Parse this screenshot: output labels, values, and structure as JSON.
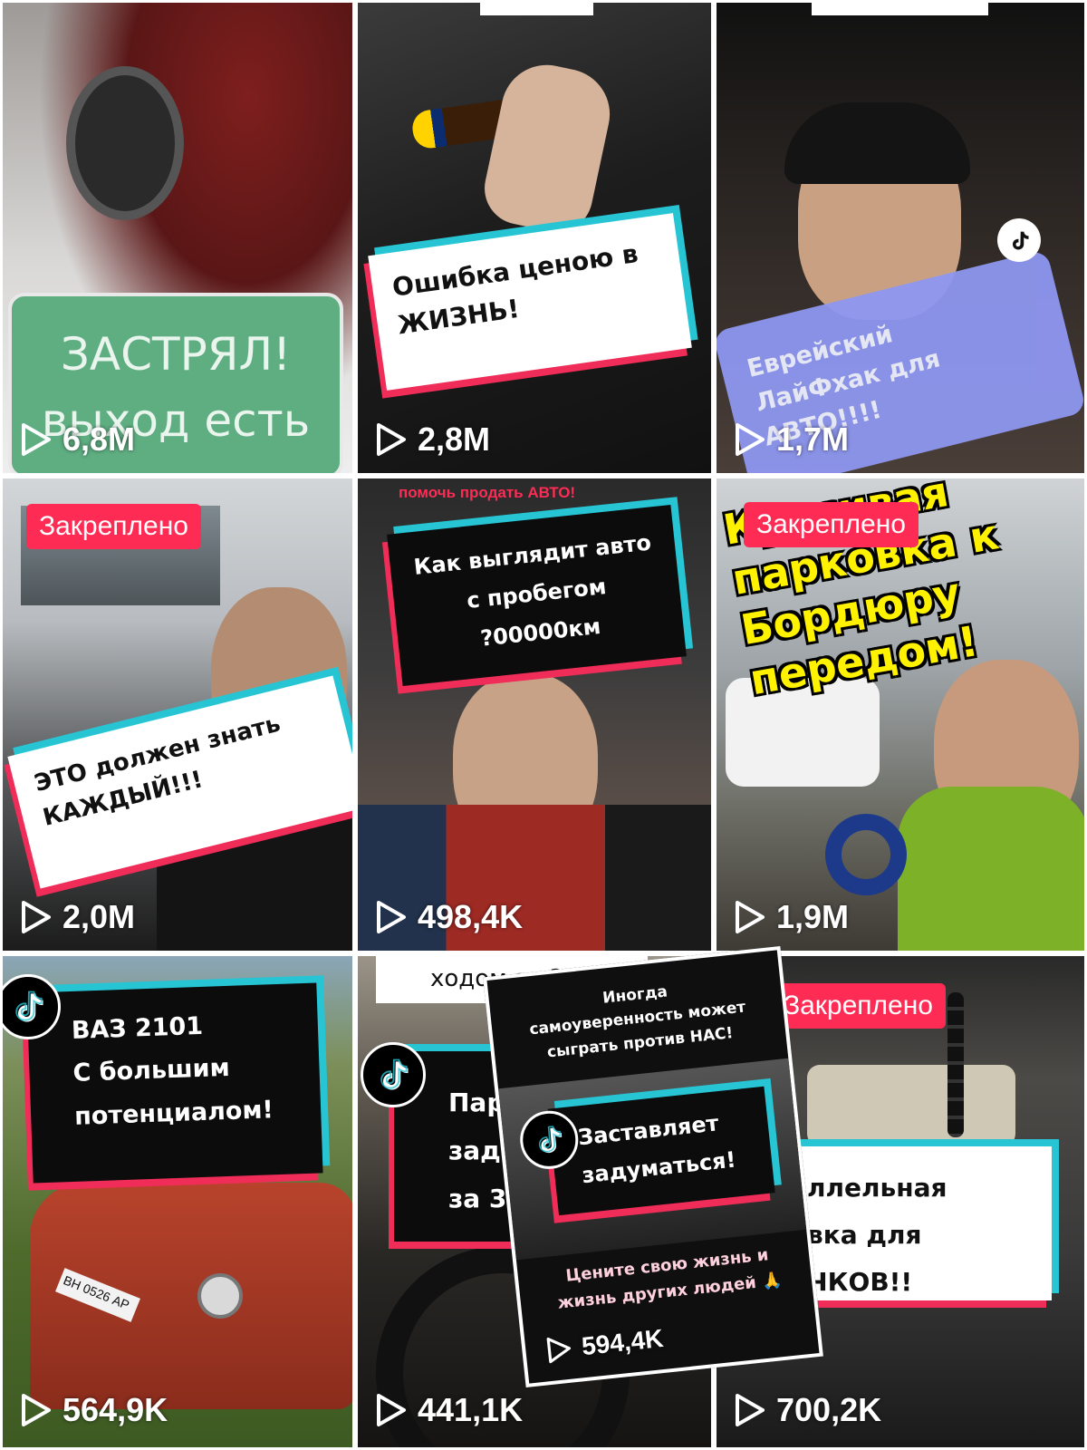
{
  "tiles": [
    {
      "id": 1,
      "caption_lines": [
        "ЗАСТРЯЛ!",
        "выход есть"
      ],
      "views": "6,8M",
      "pinned": false
    },
    {
      "id": 2,
      "caption_lines": [
        "Ошибка ценою в",
        "ЖИЗНЬ!"
      ],
      "views": "2,8M",
      "pinned": false
    },
    {
      "id": 3,
      "caption_lines": [
        "Еврейский",
        "ЛайФхак для",
        "АВТО!!!!"
      ],
      "views": "1,7M",
      "pinned": false
    },
    {
      "id": 4,
      "pinned_label": "Закреплено",
      "caption_lines": [
        "ЭТО должен знать",
        "КАЖДЫЙ!!!"
      ],
      "views": "2,0M",
      "pinned": true
    },
    {
      "id": 5,
      "top_text": "помочь продать АВТО!",
      "caption_lines": [
        "Как выглядит авто",
        "с пробегом",
        "?00000км"
      ],
      "views": "498,4K",
      "pinned": false
    },
    {
      "id": 6,
      "pinned_label": "Закреплено",
      "caption_lines": [
        "Красивая",
        "парковка к",
        "Бордюру",
        "передом!"
      ],
      "views": "1,9M",
      "pinned": true
    },
    {
      "id": 7,
      "caption_lines": [
        "ВАЗ 2101",
        "С большим",
        "потенциалом!"
      ],
      "plate": "ВН 0526 АР",
      "views": "564,9K",
      "pinned": false
    },
    {
      "id": 8,
      "top_text": "ходом за 30с",
      "caption_lines": [
        "Парк",
        "задн",
        "за 30с"
      ],
      "views": "441,1K",
      "pinned": false
    },
    {
      "id": 9,
      "pinned_label": "Закреплено",
      "caption_lines": [
        "ллельная",
        "вка для",
        "ЧКОВ!!"
      ],
      "views": "700,2K",
      "pinned": true
    }
  ],
  "overlay_card": {
    "top_lines": [
      "Иногда",
      "самоуверенность может",
      "сыграть против НАС!"
    ],
    "caption_lines": [
      "Заставляет",
      "задуматься!"
    ],
    "bottom_lines": [
      "Цените свою жизнь и",
      "жизнь других людей 🙏"
    ],
    "views": "594,4K"
  },
  "icons": {
    "play": "play-icon",
    "tiktok": "tiktok-logo-icon"
  },
  "colors": {
    "pinned_badge": "#fe2c55",
    "accent_cyan": "#27c5d4",
    "accent_red": "#f02c58",
    "green_card": "#5fae82",
    "purple_card": "#8e97f0",
    "yellow_text": "#fff200"
  }
}
